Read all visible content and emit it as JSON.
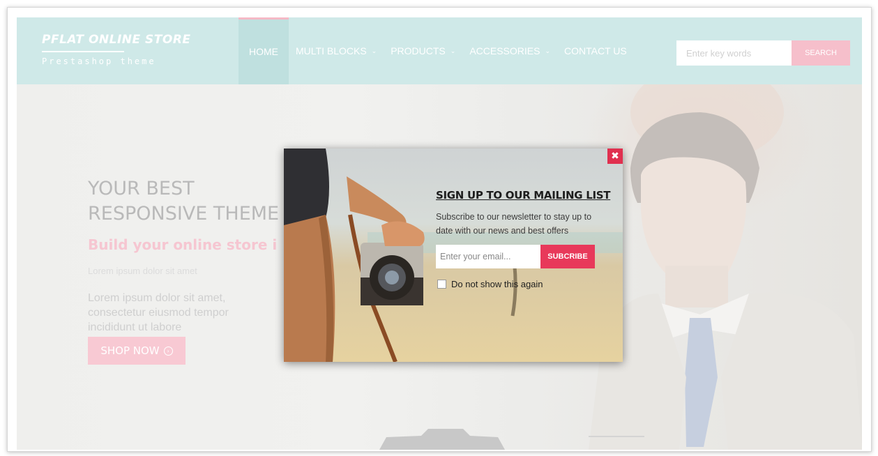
{
  "header": {
    "logo_title": "PFLAT ONLINE STORE",
    "logo_subtitle": "Prestashop theme",
    "nav": [
      {
        "label": "HOME",
        "dropdown": false,
        "active": true
      },
      {
        "label": "MULTI BLOCKS",
        "dropdown": true
      },
      {
        "label": "PRODUCTS",
        "dropdown": true
      },
      {
        "label": "ACCESSORIES",
        "dropdown": true
      },
      {
        "label": "CONTACT US",
        "dropdown": false
      }
    ],
    "search_placeholder": "Enter key words",
    "search_button": "SEARCH"
  },
  "hero": {
    "title": "YOUR BEST RESPONSIVE THEME",
    "subtitle": "Build your online store in",
    "small": "Lorem ipsum dolor sit amet",
    "paragraph": "Lorem ipsum dolor sit amet, consectetur eiusmod tempor incididunt ut labore",
    "button": "SHOP NOW"
  },
  "popup": {
    "title": "SIGN UP TO OUR MAILING LIST",
    "text": "Subscribe to our newsletter to stay up to date with our news and best offers",
    "email_placeholder": "Enter your email...",
    "subscribe_button": "SUBCRIBE",
    "checkbox_label": "Do not show this again",
    "checkbox_checked": false,
    "close_icon": "close-icon"
  },
  "colors": {
    "header_bg": "#cfe9e8",
    "accent_pink": "#f6bfcb",
    "popup_accent": "#e8395a",
    "close_red": "#e0304f"
  }
}
